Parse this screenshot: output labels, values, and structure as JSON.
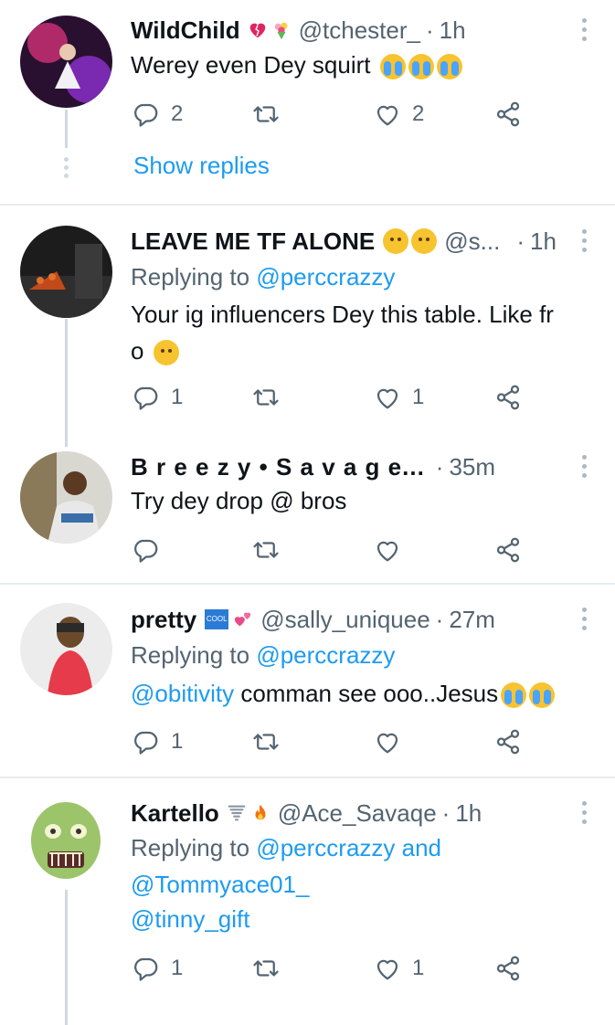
{
  "icons": [
    "reply-icon",
    "retweet-icon",
    "like-icon",
    "share-icon",
    "more-icon"
  ],
  "colors": {
    "link": "#1d9bf0",
    "muted": "#536471",
    "divider": "#e6ecf0",
    "thread": "#cfd9de"
  },
  "tweets": [
    {
      "name": "WildChild",
      "handle": "@tchester_",
      "time": "1h",
      "text": "Werey even Dey squirt",
      "reply_count": "2",
      "like_count": "2",
      "show_replies": "Show replies"
    },
    {
      "name": "LEAVE ME TF ALONE",
      "handle": "@s...",
      "time": "1h",
      "replying_to_label": "Replying to",
      "replying_to": "@perccrazzy",
      "text_line1": "Your ig influencers Dey this table. Like fr",
      "text_line2": "o",
      "reply_count": "1",
      "like_count": "1"
    },
    {
      "name": "B r e e z y • S a v a g e...",
      "time": "35m",
      "text": "Try dey drop @ bros"
    },
    {
      "name": "pretty",
      "badge": "COOL",
      "handle": "@sally_uniquee",
      "time": "27m",
      "replying_to_label": "Replying to",
      "replying_to": "@perccrazzy",
      "mention": "@obitivity",
      "text": " comman see ooo..Jesus",
      "reply_count": "1"
    },
    {
      "name": "Kartello",
      "handle": "@Ace_Savaqe",
      "time": "1h",
      "replying_to_label": "Replying to",
      "replying_to": "@perccrazzy",
      "and": " and",
      "replying_to_2": "@Tommyace01_",
      "mention": "@tinny_gift",
      "reply_count": "1",
      "like_count": "1"
    }
  ]
}
